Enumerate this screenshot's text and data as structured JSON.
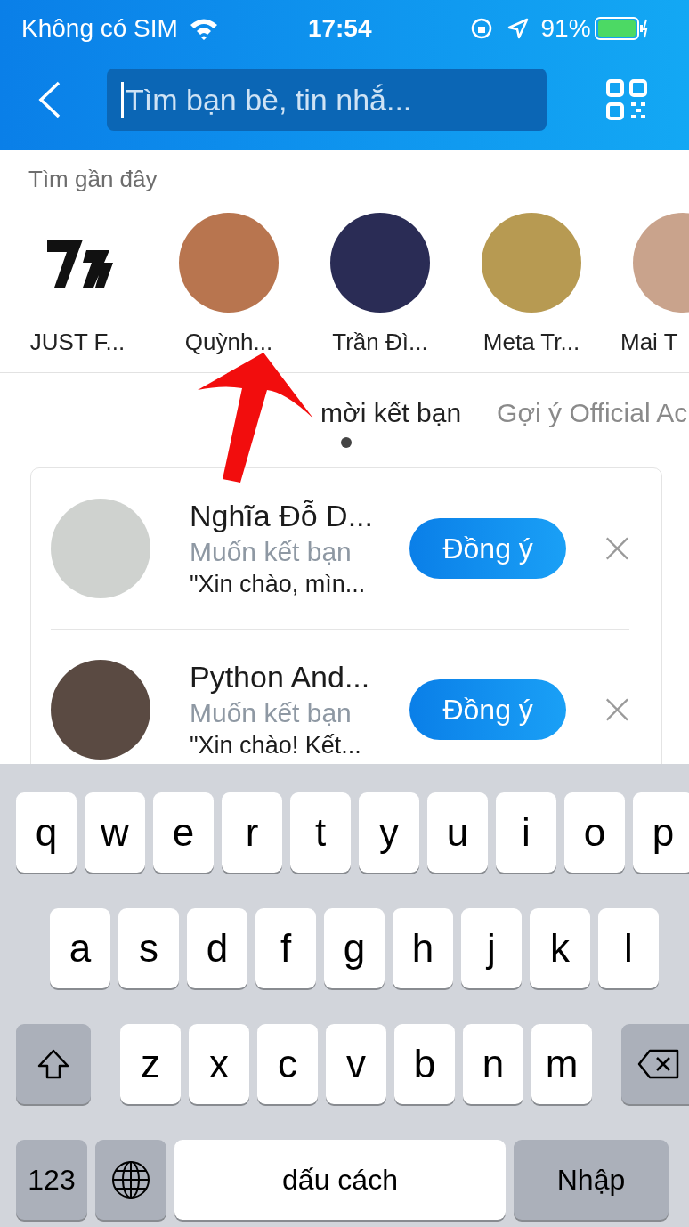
{
  "status_bar": {
    "carrier": "Không có SIM",
    "time": "17:54",
    "battery": "91%"
  },
  "search": {
    "placeholder": "Tìm bạn bè, tin nhắ..."
  },
  "recent": {
    "title": "Tìm gần đây",
    "items": [
      {
        "name": "JUST F...",
        "kind": "logo"
      },
      {
        "name": "Quỳnh...",
        "kind": "photo"
      },
      {
        "name": "Trần Đì...",
        "kind": "photo"
      },
      {
        "name": "Meta Tr...",
        "kind": "photo"
      },
      {
        "name": "Mai T",
        "kind": "photo"
      }
    ]
  },
  "tabs": [
    {
      "label": "mời kết bạn",
      "selected": true
    },
    {
      "label": "Gợi ý Official Ac",
      "selected": false
    }
  ],
  "requests": [
    {
      "name": "Nghĩa Đỗ D...",
      "status": "Muốn kết bạn",
      "message": "\"Xin chào, mìn...",
      "accept": "Đồng ý"
    },
    {
      "name": "Python And...",
      "status": "Muốn kết bạn",
      "message": "\"Xin chào! Kết...",
      "accept": "Đồng ý"
    }
  ],
  "keyboard": {
    "top_row": [
      {
        "kind": "letter",
        "label": "q"
      },
      {
        "kind": "letter",
        "label": "w"
      },
      {
        "kind": "letter",
        "label": "e"
      },
      {
        "kind": "letter",
        "label": "r"
      },
      {
        "kind": "letter",
        "label": "t"
      },
      {
        "kind": "letter",
        "label": "y"
      },
      {
        "kind": "letter",
        "label": "u"
      },
      {
        "kind": "letter",
        "label": "i"
      },
      {
        "kind": "letter",
        "label": "o"
      },
      {
        "kind": "letter",
        "label": "p"
      }
    ],
    "middle_row": [
      {
        "kind": "letter",
        "label": "a"
      },
      {
        "kind": "letter",
        "label": "s"
      },
      {
        "kind": "letter",
        "label": "d"
      },
      {
        "kind": "letter",
        "label": "f"
      },
      {
        "kind": "letter",
        "label": "g"
      },
      {
        "kind": "letter",
        "label": "h"
      },
      {
        "kind": "letter",
        "label": "j"
      },
      {
        "kind": "letter",
        "label": "k"
      },
      {
        "kind": "letter",
        "label": "l"
      }
    ],
    "bottom_row": [
      {
        "kind": "shift"
      },
      {
        "kind": "letter",
        "label": "z"
      },
      {
        "kind": "letter",
        "label": "x"
      },
      {
        "kind": "letter",
        "label": "c"
      },
      {
        "kind": "letter",
        "label": "v"
      },
      {
        "kind": "letter",
        "label": "b"
      },
      {
        "kind": "letter",
        "label": "n"
      },
      {
        "kind": "letter",
        "label": "m"
      },
      {
        "kind": "backspace"
      }
    ],
    "function_row": [
      {
        "kind": "numbers",
        "label": "123"
      },
      {
        "kind": "globe"
      },
      {
        "kind": "space",
        "label": "dấu cách"
      },
      {
        "kind": "return",
        "label": "Nhập"
      }
    ]
  }
}
